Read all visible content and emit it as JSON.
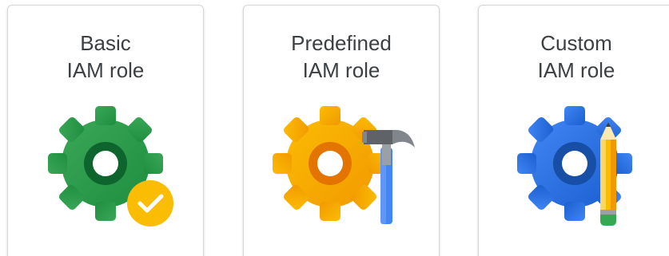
{
  "cards": [
    {
      "line1": "Basic",
      "line2": "IAM role",
      "icon": "gear-with-check-icon",
      "gear_color": "#2e9a46",
      "accent_color": "#fbbc04"
    },
    {
      "line1": "Predefined",
      "line2": "IAM role",
      "icon": "gear-with-hammer-icon",
      "gear_color": "#f9ab00",
      "accent_color": "#4285f4"
    },
    {
      "line1": "Custom",
      "line2": "IAM role",
      "icon": "gear-with-pencil-icon",
      "gear_color": "#3b78e7",
      "accent_color": "#fbbc04"
    }
  ]
}
